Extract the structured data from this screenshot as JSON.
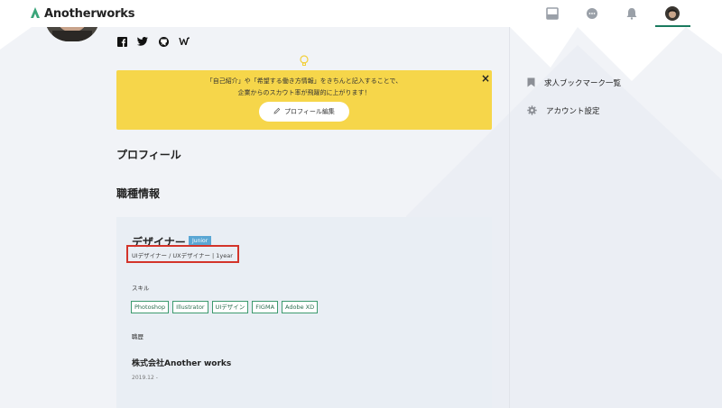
{
  "app": {
    "brand": "Anotherworks"
  },
  "banner": {
    "line1": "「自己紹介」や「希望する働き方情報」をきちんと記入することで、",
    "line2": "企業からのスカウト率が飛躍的に上がります！",
    "close": "×",
    "button_label": "プロフィール編集"
  },
  "sections": {
    "profile": "プロフィール",
    "job": "職種情報"
  },
  "job": {
    "title": "デザイナー",
    "level": "Junior",
    "subtitle": "UIデザイナー / UXデザイナー | 1year",
    "skills_label": "スキル",
    "skills": [
      "Photoshop",
      "Illustrator",
      "UIデザイン",
      "FIGMA",
      "Adobe XD"
    ],
    "history_label": "職歴",
    "company": "株式会社Another works",
    "date": "2019.12 -"
  },
  "sidebar": {
    "bookmarks": "求人ブックマーク一覧",
    "account": "アカウント設定"
  },
  "colors": {
    "accent": "#1a7a5e",
    "banner": "#f6d64a",
    "badge": "#5aa7d4",
    "highlight": "#d3342a"
  },
  "icons": [
    "logo-icon",
    "document-icon",
    "chat-icon",
    "bell-icon",
    "avatar",
    "facebook-icon",
    "twitter-icon",
    "github-icon",
    "wantedly-icon",
    "lightbulb-icon",
    "pencil-icon",
    "bookmark-icon",
    "gear-icon"
  ]
}
